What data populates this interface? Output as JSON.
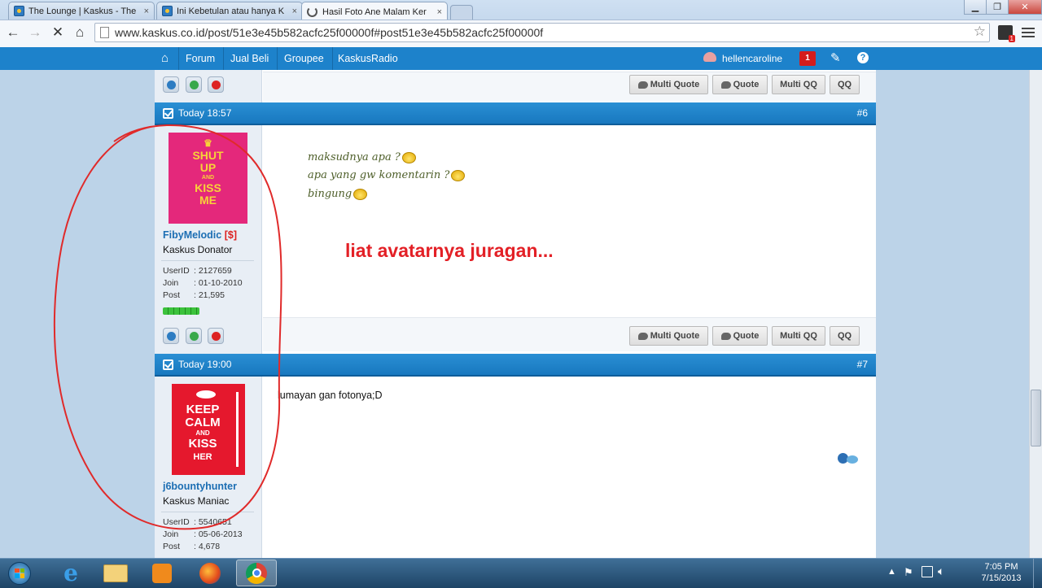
{
  "browser": {
    "tabs": [
      {
        "title": "The Lounge | Kaskus - The",
        "close": "×"
      },
      {
        "title": "Ini Kebetulan atau hanya K",
        "close": "×"
      },
      {
        "title": "Hasil Foto Ane Malam Ker",
        "close": "×"
      }
    ],
    "url": "www.kaskus.co.id/post/51e3e45b582acfc25f00000f#post51e3e45b582acfc25f00000f",
    "notification_count": "1"
  },
  "navbar": {
    "items": [
      "Forum",
      "Jual Beli",
      "Groupee",
      "KaskusRadio"
    ],
    "username": "hellencaroline",
    "notif_badge": "1"
  },
  "buttons": {
    "multi_quote": "Multi Quote",
    "quote": "Quote",
    "multi_qq": "Multi QQ",
    "qq": "QQ"
  },
  "posts": [
    {
      "time": "Today 18:57",
      "number": "#6",
      "avatar_text": [
        "SHUT",
        "UP",
        "AND",
        "KISS",
        "ME"
      ],
      "username": "FibyMelodic",
      "donor_tag": "[$]",
      "rank": "Kaskus Donator",
      "userid_label": "UserID",
      "userid": ": 2127659",
      "join_label": "Join",
      "join": ": 01-10-2010",
      "post_label": "Post",
      "post": ": 21,595",
      "lines": [
        "maksudnya apa ?",
        "apa yang gw komentarin ?",
        "bingung"
      ],
      "annotation": "liat avatarnya juragan..."
    },
    {
      "time": "Today 19:00",
      "number": "#7",
      "avatar_text": [
        "KEEP",
        "CALM",
        "AND",
        "KISS",
        "HER"
      ],
      "username": "j6bountyhunter",
      "rank": "Kaskus Maniac",
      "userid_label": "UserID",
      "userid": ": 5540651",
      "join_label": "Join",
      "join": ": 05-06-2013",
      "post_label": "Post",
      "post": ": 4,678",
      "message": "lumayan gan fotonya;D"
    }
  ],
  "taskbar": {
    "time": "7:05 PM",
    "date": "7/15/2013"
  },
  "colors": {
    "accent": "#1d82cb",
    "annotation": "#e32026",
    "circle": "#e02a2a"
  }
}
